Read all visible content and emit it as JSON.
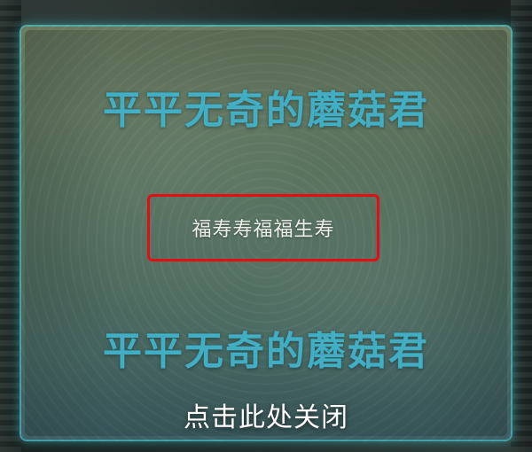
{
  "watermarks": {
    "top": "平平无奇的蘑菇君",
    "bottom": "平平无奇的蘑菇君"
  },
  "dialog": {
    "name_value": "福寿寿福福生寿",
    "close_hint": "点击此处关闭"
  },
  "colors": {
    "highlight_border": "#e10f12",
    "watermark_text": "#46bed7",
    "panel_glow": "#46d2dc"
  }
}
